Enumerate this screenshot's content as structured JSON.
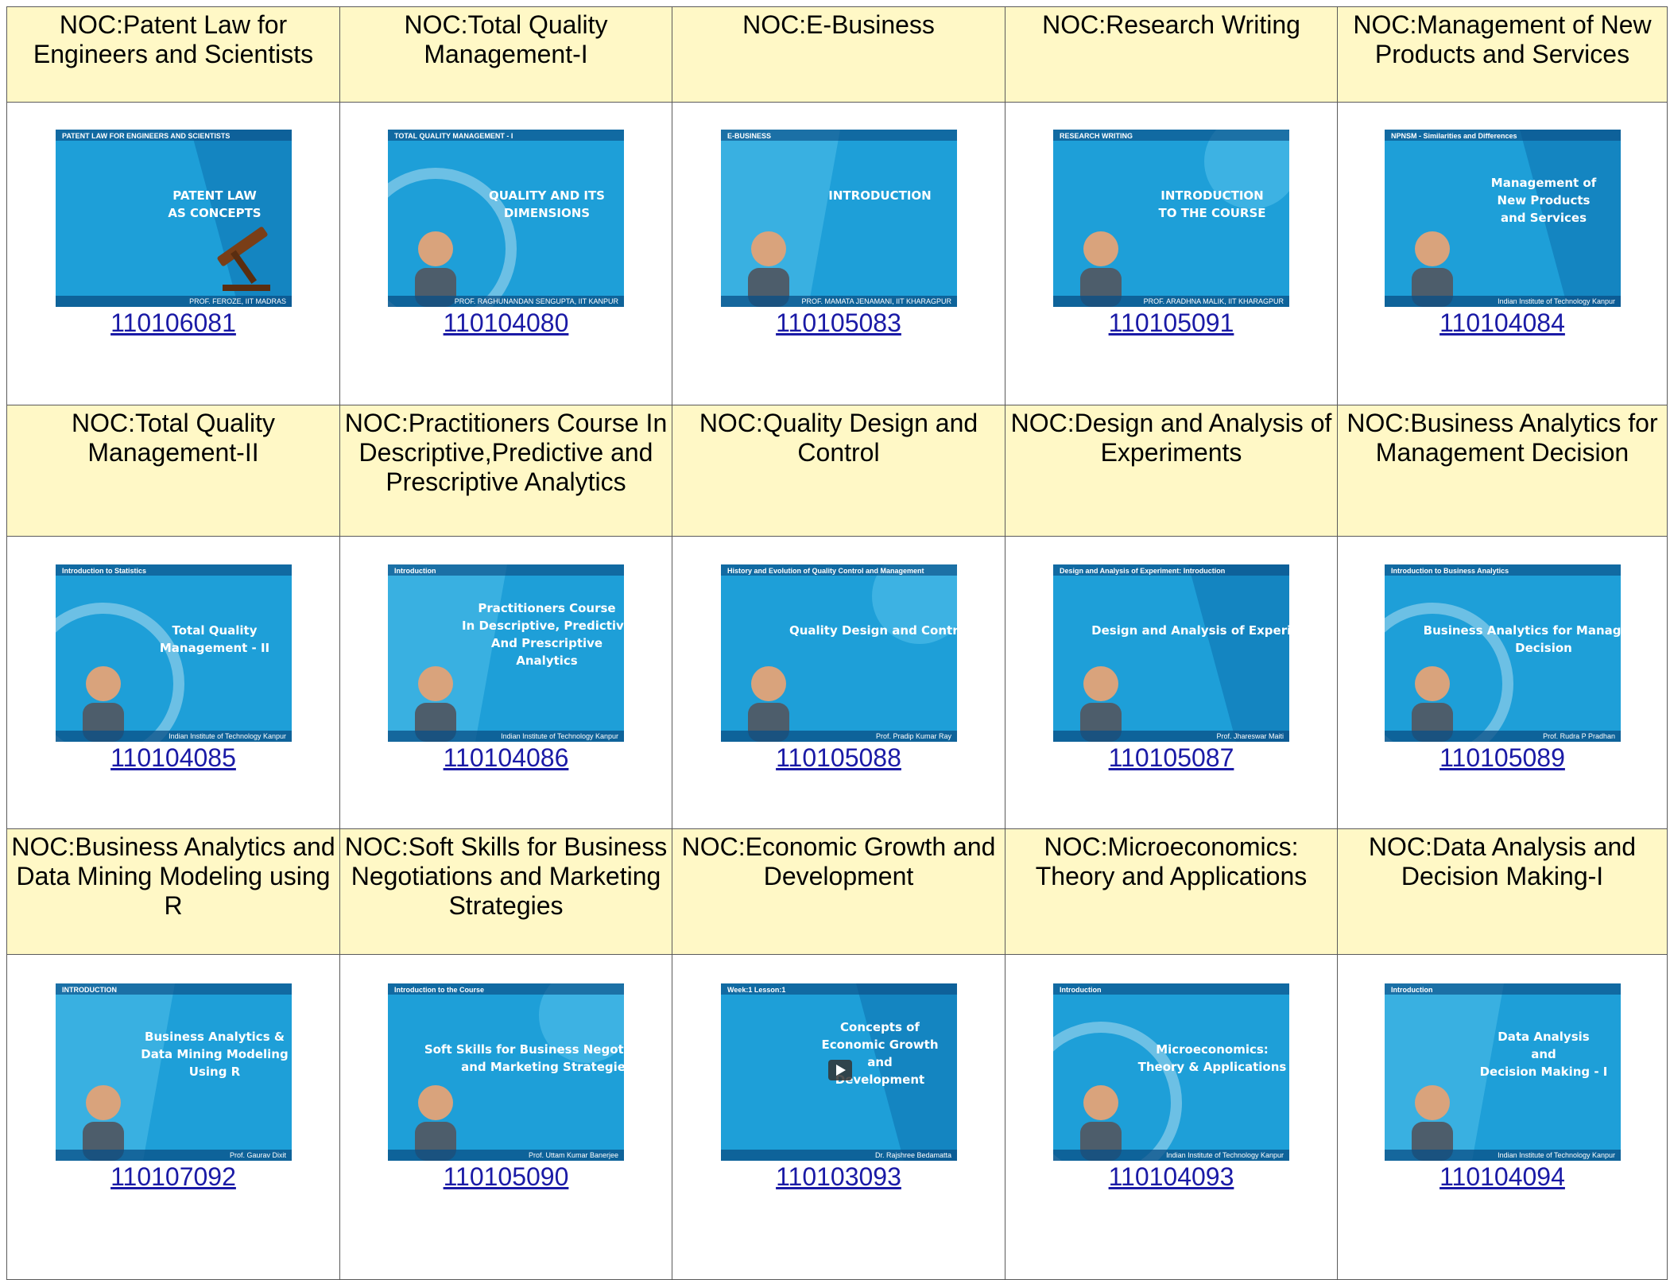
{
  "rows": [
    {
      "courses": [
        {
          "title": "NOC:Patent Law for Engineers and Scientists",
          "code": "110106081",
          "thumb": {
            "lines": [
              "PATENT LAW",
              "AS CONCEPTS"
            ],
            "sub": "PATENT LAW FOR ENGINEERS AND SCIENTISTS",
            "footer": "PROF. FEROZE, IIT MADRAS",
            "icon": "gavel-icon"
          }
        },
        {
          "title": "NOC:Total Quality Management-I",
          "code": "110104080",
          "thumb": {
            "lines": [
              "QUALITY AND ITS",
              "DIMENSIONS"
            ],
            "sub": "TOTAL QUALITY MANAGEMENT - I",
            "footer": "PROF. RAGHUNANDAN SENGUPTA, IIT KANPUR",
            "icon": "presenter-icon"
          }
        },
        {
          "title": "NOC:E-Business",
          "code": "110105083",
          "thumb": {
            "lines": [
              "INTRODUCTION"
            ],
            "sub": "E-BUSINESS",
            "footer": "PROF. MAMATA JENAMANI, IIT KHARAGPUR",
            "icon": "presenter-icon"
          }
        },
        {
          "title": "NOC:Research Writing",
          "code": "110105091",
          "thumb": {
            "lines": [
              "INTRODUCTION",
              "TO THE COURSE"
            ],
            "sub": "RESEARCH WRITING",
            "footer": "PROF. ARADHNA MALIK, IIT KHARAGPUR",
            "icon": "presenter-icon"
          }
        },
        {
          "title": "NOC:Management of New Products and Services",
          "code": "110104084",
          "thumb": {
            "lines": [
              "Management of",
              "New Products",
              "and Services"
            ],
            "sub": "NPNSM - Similarities and Differences",
            "footer": "Indian Institute of Technology Kanpur",
            "icon": "presenter-icon"
          }
        }
      ]
    },
    {
      "courses": [
        {
          "title": "NOC:Total Quality Management-II",
          "code": "110104085",
          "thumb": {
            "lines": [
              "Total Quality",
              "Management - II"
            ],
            "sub": "Introduction to Statistics",
            "footer": "Indian Institute of Technology Kanpur",
            "icon": "presenter-icon"
          }
        },
        {
          "title": "NOC:Practitioners Course In Descriptive,Predictive and Prescriptive Analytics",
          "code": "110104086",
          "thumb": {
            "lines": [
              "Practitioners Course",
              "In Descriptive, Predictive",
              "And Prescriptive",
              "Analytics"
            ],
            "sub": "Introduction",
            "footer": "Indian Institute of Technology Kanpur",
            "icon": "presenter-icon"
          }
        },
        {
          "title": "NOC:Quality Design and Control",
          "code": "110105088",
          "thumb": {
            "lines": [
              "Quality Design and Control"
            ],
            "sub": "History and Evolution of Quality Control and Management",
            "footer": "Prof. Pradip Kumar Ray",
            "icon": "presenter-icon"
          }
        },
        {
          "title": "NOC:Design and Analysis of Experiments",
          "code": "110105087",
          "thumb": {
            "lines": [
              "Design and Analysis of Experiments"
            ],
            "sub": "Design and Analysis of Experiment: Introduction",
            "footer": "Prof. Jhareswar Maiti",
            "icon": "presenter-icon"
          }
        },
        {
          "title": "NOC:Business Analytics for Management Decision",
          "code": "110105089",
          "thumb": {
            "lines": [
              "Business Analytics for Management",
              "Decision"
            ],
            "sub": "Introduction to Business Analytics",
            "footer": "Prof. Rudra P Pradhan",
            "icon": "presenter-icon"
          }
        }
      ]
    },
    {
      "courses": [
        {
          "title": "NOC:Business Analytics and Data Mining Modeling using R",
          "code": "110107092",
          "thumb": {
            "lines": [
              "Business Analytics &",
              "Data Mining Modeling",
              "Using R"
            ],
            "sub": "INTRODUCTION",
            "footer": "Prof. Gaurav Dixit",
            "icon": "presenter-icon"
          }
        },
        {
          "title": "NOC:Soft Skills for Business Negotiations and Marketing Strategies",
          "code": "110105090",
          "thumb": {
            "lines": [
              "Soft Skills for Business Negotiations",
              "and Marketing Strategies"
            ],
            "sub": "Introduction to the Course",
            "footer": "Prof. Uttam Kumar Banerjee",
            "icon": "presenter-icon"
          }
        },
        {
          "title": "NOC:Economic Growth and Development",
          "code": "110103093",
          "thumb": {
            "lines": [
              "Concepts of",
              "Economic Growth",
              "and",
              "Development"
            ],
            "sub": "Week:1 Lesson:1",
            "footer": "Dr. Rajshree Bedamatta",
            "icon": "play-icon"
          }
        },
        {
          "title": "NOC:Microeconomics: Theory and Applications",
          "code": "110104093",
          "thumb": {
            "lines": [
              "Microeconomics:",
              "Theory & Applications"
            ],
            "sub": "Introduction",
            "footer": "Indian Institute of Technology Kanpur",
            "icon": "presenter-icon"
          }
        },
        {
          "title": "NOC:Data Analysis and Decision Making-I",
          "code": "110104094",
          "thumb": {
            "lines": [
              "Data Analysis",
              "and",
              "Decision Making - I"
            ],
            "sub": "Introduction",
            "footer": "Indian Institute of Technology Kanpur",
            "icon": "presenter-icon"
          }
        }
      ]
    }
  ],
  "colors": {
    "title_bg": "#fff8c6",
    "link": "#1a1aa6",
    "border": "#5a5a5a",
    "thumb_blue": "#1e9fd8",
    "thumb_dark": "#0d6fae",
    "thumb_light": "#5cc6ee"
  }
}
